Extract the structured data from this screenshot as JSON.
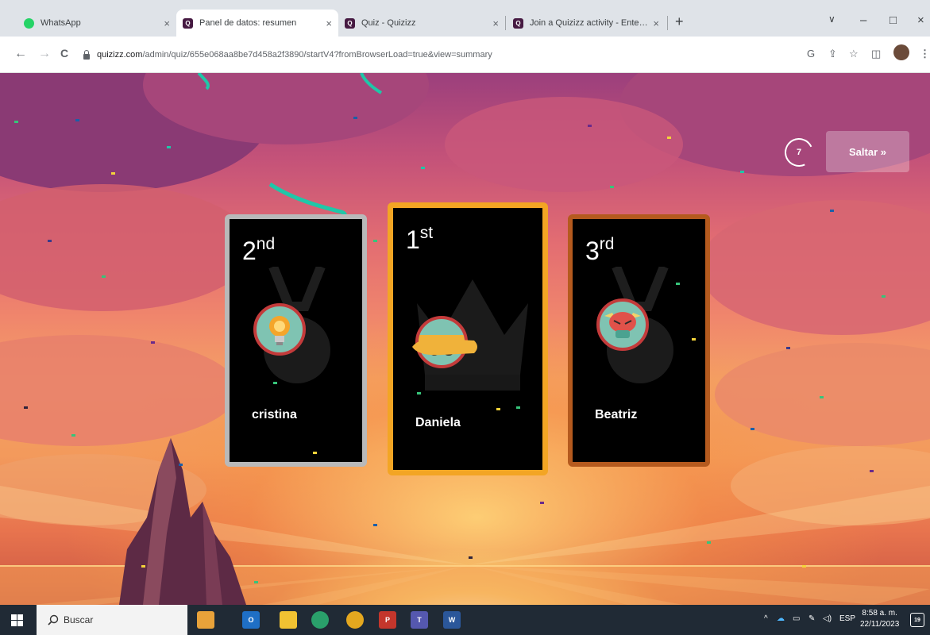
{
  "tabs": [
    {
      "title": "WhatsApp",
      "favicon": "whatsapp-icon",
      "active": false
    },
    {
      "title": "Panel de datos: resumen",
      "favicon": "quizizz-icon",
      "active": true
    },
    {
      "title": "Quiz - Quizizz",
      "favicon": "quizizz-icon",
      "active": false
    },
    {
      "title": "Join a Quizizz activity - Enter co",
      "favicon": "quizizz-icon",
      "active": false
    }
  ],
  "tab_close": "×",
  "new_tab": "+",
  "window_controls": {
    "dropdown": "∨",
    "minimize": "–",
    "maximize": "□",
    "close": "×"
  },
  "nav": {
    "back": "←",
    "forward": "→",
    "reload": "C"
  },
  "url": {
    "host": "quizizz.com",
    "path": "/admin/quiz/655e068aa8be7d458a2f3890/startV4?fromBrowserLoad=true&view=summary"
  },
  "extensions": [
    "G",
    "⇪",
    "☆",
    "◫"
  ],
  "game": {
    "skip_label": "Saltar »",
    "timer_value": "7",
    "podium": [
      {
        "place": "2",
        "suffix": "nd",
        "name": "cristina",
        "avatar": "lightbulb-avatar-icon",
        "frame": "#b9b9b9"
      },
      {
        "place": "1",
        "suffix": "st",
        "name": "Daniela",
        "avatar": "sleeping-avatar-icon",
        "frame": "#f3a524"
      },
      {
        "place": "3",
        "suffix": "rd",
        "name": "Beatriz",
        "avatar": "monster-avatar-icon",
        "frame": "#b55a1e"
      }
    ]
  },
  "taskbar": {
    "search_placeholder": "Buscar",
    "language": "ESP",
    "time": "8:58 a. m.",
    "date": "22/11/2023",
    "notification_count": "19"
  },
  "colors": {
    "tabbar": "#dfe3e8",
    "taskbar": "#202a35",
    "sky_top": "#9b3f7c",
    "sky_bottom": "#f4a065",
    "gold": "#f3a524",
    "silver": "#b9b9b9",
    "bronze": "#b55a1e"
  }
}
